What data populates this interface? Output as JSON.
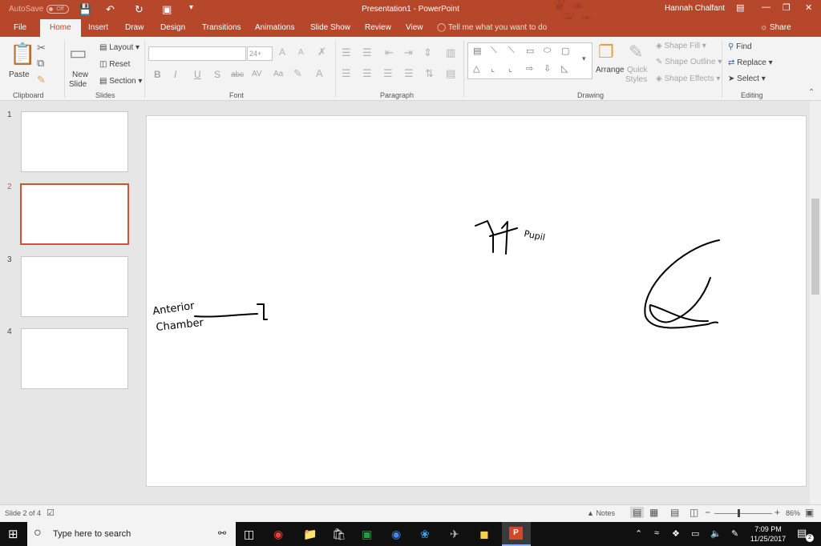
{
  "window": {
    "autosave_label": "AutoSave",
    "autosave_state": "Off",
    "doc_title": "Presentation1  -  PowerPoint",
    "user_name": "Hannah Chalfant",
    "accent_color": "#b7472a"
  },
  "tabs": [
    "File",
    "Home",
    "Insert",
    "Draw",
    "Design",
    "Transitions",
    "Animations",
    "Slide Show",
    "Review",
    "View"
  ],
  "active_tab": "Home",
  "tell_me": "Tell me what you want to do",
  "share_label": "Share",
  "ribbon": {
    "clipboard": {
      "label": "Clipboard",
      "paste": "Paste"
    },
    "slides": {
      "label": "Slides",
      "new_slide_1": "New",
      "new_slide_2": "Slide",
      "layout": "Layout",
      "reset": "Reset",
      "section": "Section"
    },
    "font": {
      "label": "Font",
      "font_name": "",
      "font_size": "24+",
      "bold": "B",
      "italic": "I",
      "underline": "U",
      "shadow": "S",
      "strike": "abc",
      "spacing": "AV",
      "case": "Aa",
      "grow": "A",
      "shrink": "A"
    },
    "paragraph": {
      "label": "Paragraph"
    },
    "drawing": {
      "label": "Drawing",
      "arrange": "Arrange",
      "quick_styles_1": "Quick",
      "quick_styles_2": "Styles",
      "shape_fill": "Shape Fill",
      "shape_outline": "Shape Outline",
      "shape_effects": "Shape Effects"
    },
    "editing": {
      "label": "Editing",
      "find": "Find",
      "replace": "Replace",
      "select": "Select"
    }
  },
  "slides": [
    {
      "number": "1"
    },
    {
      "number": "2",
      "selected": true
    },
    {
      "number": "3"
    },
    {
      "number": "4"
    }
  ],
  "slide_ink": {
    "label_1a": "Anterior",
    "label_1b": "Chamber",
    "label_2": "Pupil"
  },
  "status": {
    "slide_info": "Slide 2 of 4",
    "notes": "Notes",
    "zoom": "86%"
  },
  "taskbar": {
    "search_placeholder": "Type here to search",
    "time": "7:09 PM",
    "date": "11/25/2017",
    "notification_count": "2"
  }
}
